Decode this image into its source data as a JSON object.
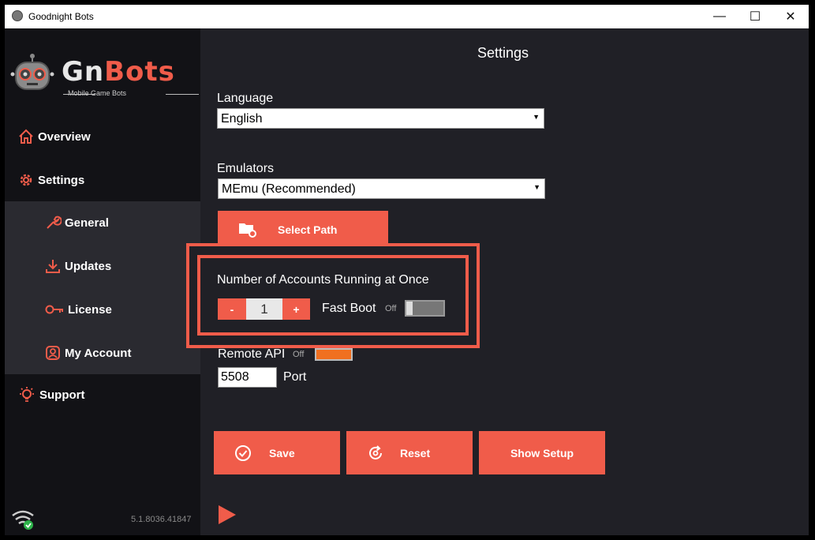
{
  "window": {
    "title": "Goodnight Bots",
    "minimize_glyph": "—",
    "maximize_glyph": "☐",
    "close_glyph": "✕"
  },
  "logo": {
    "brand_prefix": "Gn",
    "brand_suffix": "Bots",
    "tagline": "Mobile Game Bots"
  },
  "sidebar": {
    "overview": "Overview",
    "settings": "Settings",
    "general": "General",
    "updates": "Updates",
    "license": "License",
    "my_account": "My Account",
    "support": "Support",
    "version": "5.1.8036.41847"
  },
  "settings": {
    "title": "Settings",
    "language_label": "Language",
    "language_value": "English",
    "emulators_label": "Emulators",
    "emulator_value": "MEmu (Recommended)",
    "select_path": "Select Path",
    "accounts_label": "Number of Accounts Running at Once",
    "accounts_minus": "-",
    "accounts_value": "1",
    "accounts_plus": "+",
    "fast_boot_label": "Fast Boot",
    "fast_boot_state": "Off",
    "remote_api_label": "Remote API",
    "remote_api_state": "Off",
    "port_value": "5508",
    "port_label": "Port",
    "save": "Save",
    "reset": "Reset",
    "show_setup": "Show Setup"
  },
  "colors": {
    "accent": "#f05c4a",
    "background": "#202026",
    "sidebar": "#121216",
    "submenu": "#2a2a30",
    "remote_api_toggle": "#f07020"
  },
  "icons": [
    "app-icon",
    "home-icon",
    "gear-icon",
    "wrench-icon",
    "download-icon",
    "key-icon",
    "account-icon",
    "lightbulb-icon",
    "wifi-icon",
    "folder-gear-icon",
    "check-circle-icon",
    "reset-icon",
    "play-icon"
  ]
}
